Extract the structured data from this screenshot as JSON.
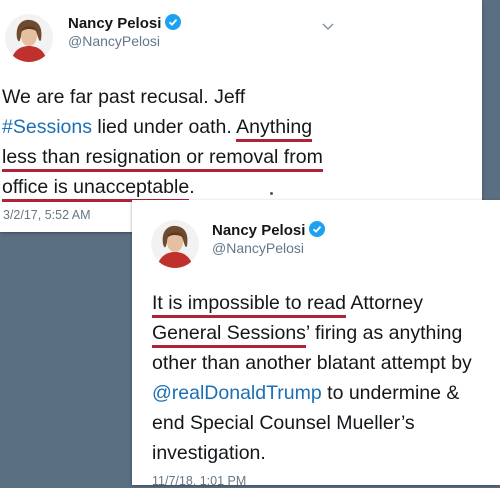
{
  "tweet1": {
    "name": "Nancy Pelosi",
    "handle": "@NancyPelosi",
    "lines": [
      {
        "a": "We are far past recusal. Jeff"
      },
      {
        "hashtag": "#Sessions",
        "a": " lied under oath. ",
        "ul": "Anything"
      },
      {
        "ul": "less than resignation or removal from"
      },
      {
        "ul": "office is unacceptable",
        "a": "."
      }
    ],
    "timestamp": "3/2/17, 5:52 AM"
  },
  "tweet2": {
    "name": "Nancy Pelosi",
    "handle": "@NancyPelosi",
    "lines": [
      {
        "ul": "It is impossible to read",
        "a": " Attorney"
      },
      {
        "ul": "General Sessions",
        "a": "’ firing as anything"
      },
      {
        "a": "other than another blatant attempt by"
      },
      {
        "mention": "@realDonaldTrump",
        "a": " to undermine &"
      },
      {
        "a": "end Special Counsel Mueller’s"
      },
      {
        "a": "investigation."
      }
    ],
    "timestamp": "11/7/18, 1:01 PM"
  },
  "colors": {
    "link": "#1d6fb5",
    "underline": "#b0213a",
    "verified": "#1da1f2",
    "background": "#5b6f82"
  },
  "icons": [
    "verified-badge-icon",
    "chevron-down-icon",
    "avatar"
  ]
}
